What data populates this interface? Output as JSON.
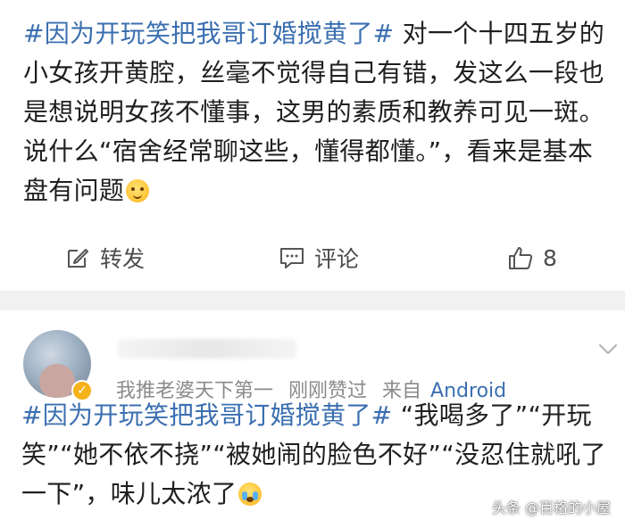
{
  "post": {
    "hashtag": "#因为开玩笑把我哥订婚搅黄了#",
    "body": " 对一个十四五岁的小女孩开黄腔，丝毫不觉得自己有错，发这么一段也是想说明女孩不懂事，这男的素质和教养可见一斑。说什么“宿舍经常聊这些，懂得都懂。”，看来是基本盘有问题",
    "emoji": "smile-sweat-emoji"
  },
  "actions": {
    "repost_label": "转发",
    "comment_label": "评论",
    "like_count": "8",
    "repost_icon": "edit-square-icon",
    "comment_icon": "comment-bubble-icon",
    "like_icon": "thumbs-up-icon"
  },
  "comment": {
    "meta_signature": "我推老婆天下第一",
    "meta_liked": "刚刚赞过",
    "meta_from": "来自",
    "meta_device": "Android",
    "hashtag": "#因为开玩笑把我哥订婚搅黄了#",
    "body": " “我喝多了”“开玩笑”“她不依不挠”“被她闹的脸色不好”“没忍住就吼了一下”，味儿太浓了",
    "emoji": "crying-emoji"
  },
  "watermark": "头条 @百格的小屋",
  "colors": {
    "link": "#3b6fb0",
    "text": "#1f1f1f",
    "muted": "#8a8a8a",
    "divider": "#f1f1f1"
  }
}
